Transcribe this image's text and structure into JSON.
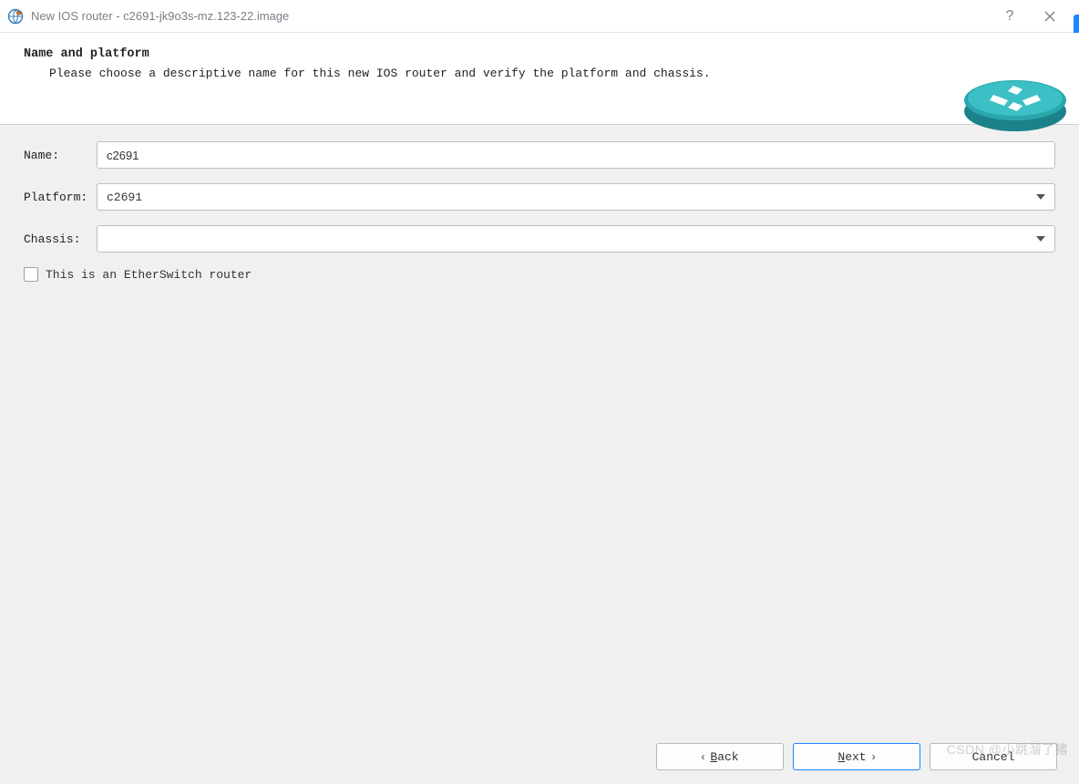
{
  "window": {
    "title": "New IOS router - c2691-jk9o3s-mz.123-22.image"
  },
  "header": {
    "heading": "Name and platform",
    "subtext": "Please choose a descriptive name for this new IOS router and verify the platform and chassis."
  },
  "form": {
    "name_label": "Name:",
    "name_value": "c2691",
    "platform_label": "Platform:",
    "platform_value": "c2691",
    "chassis_label": "Chassis:",
    "chassis_value": "",
    "etherswitch_label": "This is an EtherSwitch router",
    "etherswitch_checked": false
  },
  "footer": {
    "back_label": "Back",
    "next_label": "Next",
    "cancel_label": "Cancel"
  },
  "watermark": "CSDN @小跳溜了猪"
}
